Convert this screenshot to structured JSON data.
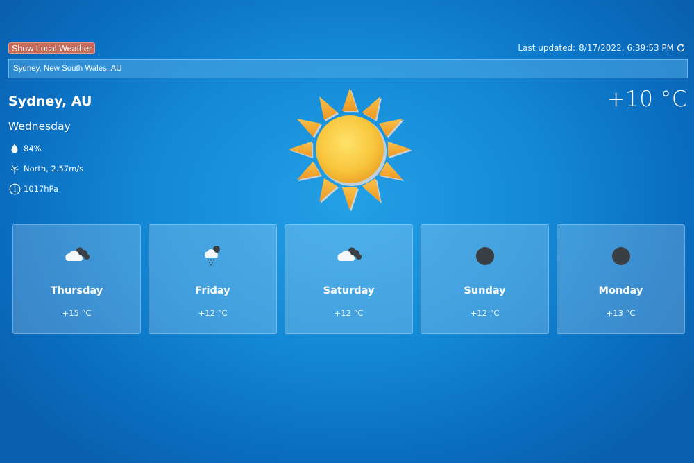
{
  "header": {
    "local_button_label": "Show Local Weather",
    "last_updated_label": "Last updated:",
    "last_updated_value": "8/17/2022, 6:39:53 PM",
    "refresh_icon": "refresh-icon"
  },
  "search": {
    "value": "Sydney, New South Wales, AU"
  },
  "current": {
    "city": "Sydney, AU",
    "day": "Wednesday",
    "temperature": "+10 °C",
    "condition_icon": "sun-icon",
    "humidity": "84%",
    "humidity_icon": "droplet-icon",
    "wind": "North, 2.57m/s",
    "wind_icon": "wind-icon",
    "pressure": "1017hPa",
    "pressure_icon": "pressure-gauge-icon"
  },
  "forecast": [
    {
      "day": "Thursday",
      "temp": "+15 °C",
      "icon": "partly-cloudy-icon"
    },
    {
      "day": "Friday",
      "temp": "+12 °C",
      "icon": "rain-cloud-icon"
    },
    {
      "day": "Saturday",
      "temp": "+12 °C",
      "icon": "partly-cloudy-icon"
    },
    {
      "day": "Sunday",
      "temp": "+12 °C",
      "icon": "dark-circle-icon"
    },
    {
      "day": "Monday",
      "temp": "+13 °C",
      "icon": "dark-circle-icon"
    }
  ],
  "colors": {
    "background": "#1489d6",
    "button": "#c8695a",
    "sun": "#f6c23e",
    "sun_rays": "#f4a52a",
    "dark_icon": "#3a3f46"
  }
}
